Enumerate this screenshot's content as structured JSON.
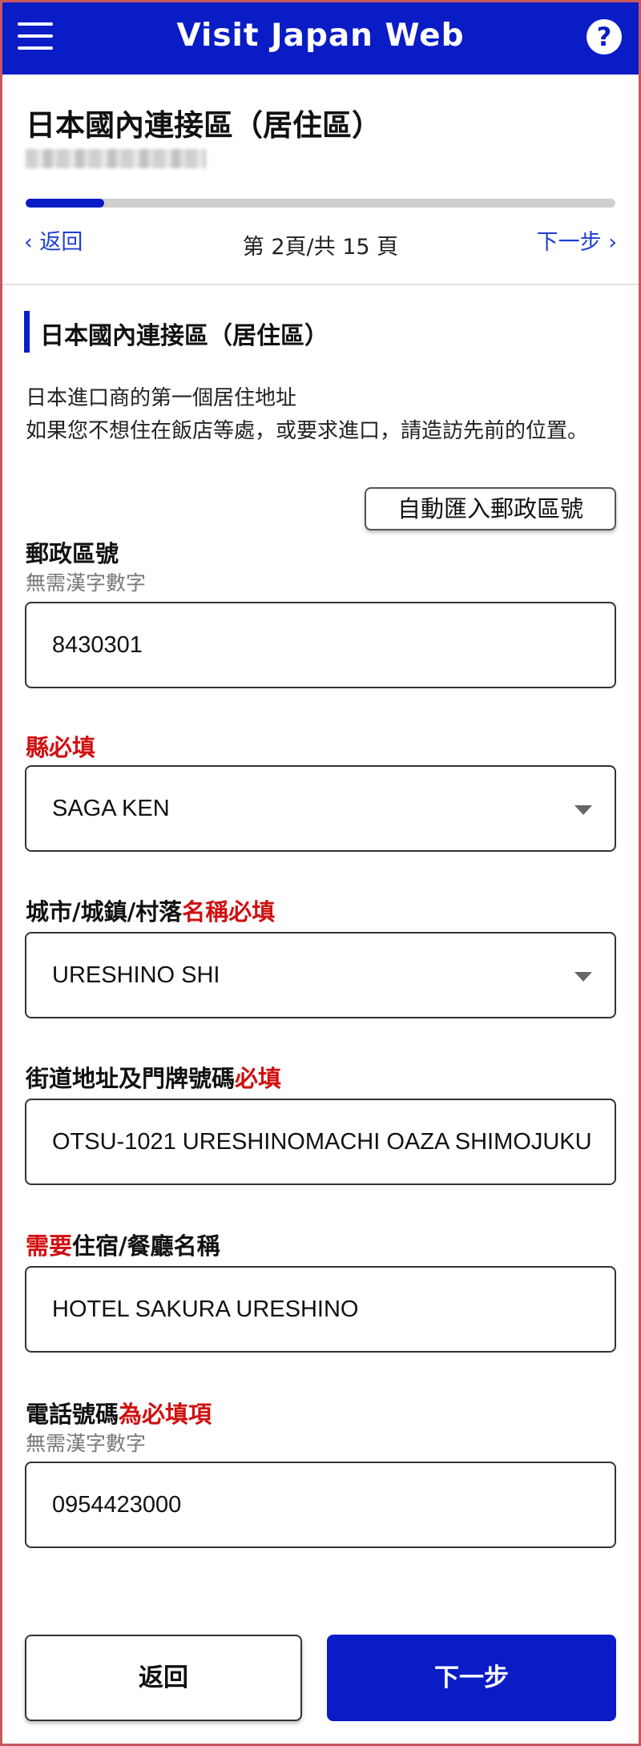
{
  "app": {
    "title": "Visit Japan Web",
    "help_label": "?"
  },
  "header": {
    "heading": "日本國內連接區（居住區）"
  },
  "progress": {
    "fraction": 0.133
  },
  "nav": {
    "back_label": "返回",
    "next_label": "下一步",
    "page_indicator": "第 2頁/共 15 頁"
  },
  "section": {
    "title": "日本國內連接區（居住區）",
    "description_line1": "日本進口商的第一個居住地址",
    "description_line2": "如果您不想住在飯店等處，或要求進口，請造訪先前的位置。"
  },
  "auto_postal_button": "自動匯入郵政區號",
  "postal": {
    "label": "郵政區號",
    "hint": "無需漢字數字",
    "value": "8430301"
  },
  "prefecture": {
    "label_required": "縣必填",
    "value": "SAGA KEN"
  },
  "city": {
    "label": "城市/城鎮/村落",
    "label_required": "名稱必填",
    "value": "URESHINO SHI"
  },
  "street": {
    "label": "街道地址及門牌號碼",
    "label_required": "必填",
    "value": "OTSU-1021 URESHINOMACHI OAZA SHIMOJUKU"
  },
  "accommodation": {
    "label_required": "需要",
    "label": "住宿/餐廳名稱",
    "value": "HOTEL SAKURA URESHINO"
  },
  "phone": {
    "label": "電話號碼",
    "label_required": "為必填項",
    "hint": "無需漢字數字",
    "value": "0954423000"
  },
  "footer": {
    "back_button": "返回",
    "next_button": "下一步"
  },
  "colors": {
    "brand": "#0a1cc6",
    "required": "#d10f10"
  }
}
